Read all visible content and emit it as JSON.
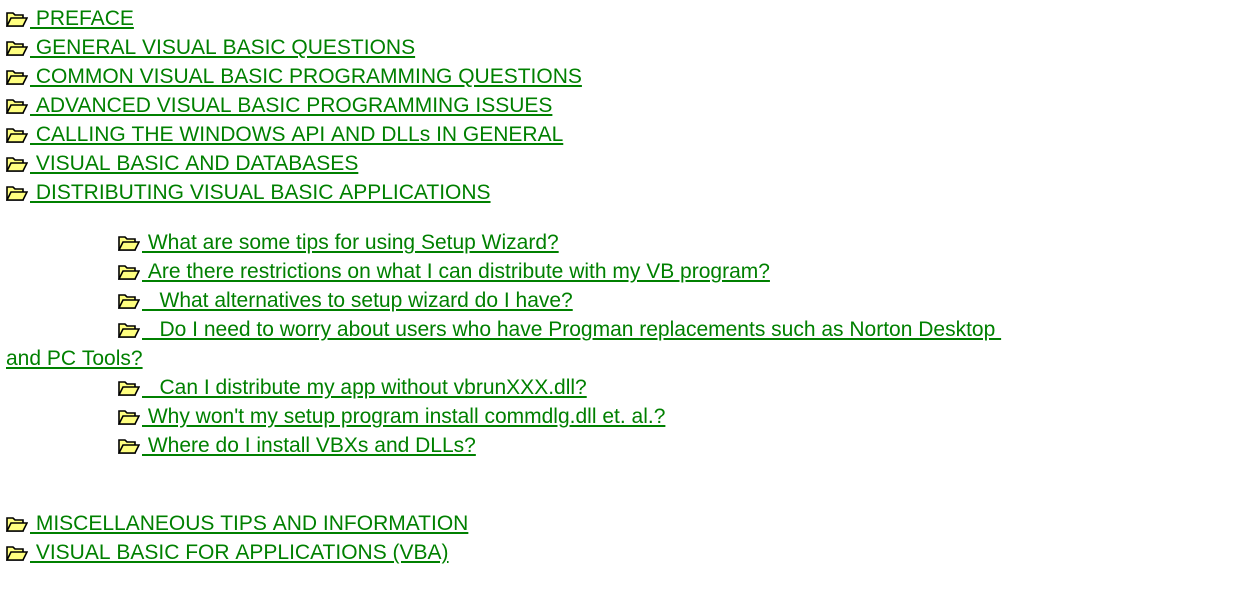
{
  "top_sections": [
    {
      "label": " PREFACE"
    },
    {
      "label": " GENERAL VISUAL BASIC QUESTIONS"
    },
    {
      "label": " COMMON VISUAL BASIC PROGRAMMING QUESTIONS"
    },
    {
      "label": " ADVANCED VISUAL BASIC PROGRAMMING ISSUES"
    },
    {
      "label": " CALLING THE WINDOWS API AND DLLs IN GENERAL"
    },
    {
      "label": " VISUAL BASIC AND DATABASES"
    },
    {
      "label": " DISTRIBUTING VISUAL BASIC APPLICATIONS"
    }
  ],
  "sub_topics": [
    {
      "label": " What are some tips for using Setup Wizard?"
    },
    {
      "label": " Are there restrictions on what I can distribute with my VB program?"
    },
    {
      "label": "   What alternatives to setup wizard do I have?"
    },
    {
      "label": "   Do I need to worry about users who have Progman replacements such as Norton Desktop "
    },
    {
      "label": "and PC Tools?"
    },
    {
      "label": "   Can I distribute my app without vbrunXXX.dll?"
    },
    {
      "label": " Why won't my setup program install commdlg.dll et. al.?"
    },
    {
      "label": " Where do I install VBXs and DLLs?"
    }
  ],
  "bottom_sections": [
    {
      "label": " MISCELLANEOUS TIPS AND INFORMATION"
    },
    {
      "label": " VISUAL BASIC FOR APPLICATIONS (VBA)"
    }
  ],
  "icons": {
    "folder": "folder-open-icon",
    "link_color": "#008000",
    "folder_fill": "#ffff80",
    "folder_stroke": "#000000"
  }
}
